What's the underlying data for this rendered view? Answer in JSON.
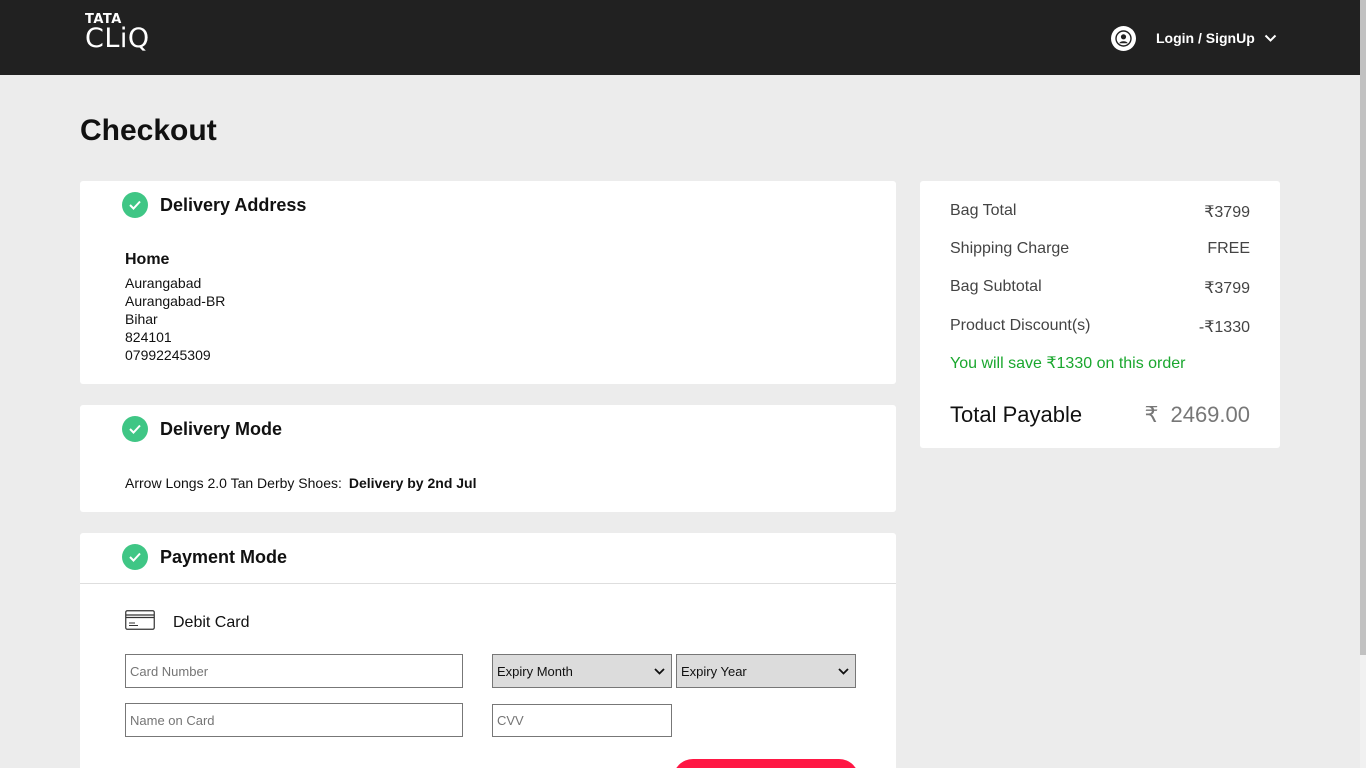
{
  "header": {
    "logo_top": "TATA",
    "logo_bottom": "CLiQ",
    "account_label": "Login / SignUp"
  },
  "page_title": "Checkout",
  "delivery_address": {
    "title": "Delivery Address",
    "label": "Home",
    "lines": [
      "Aurangabad",
      "Aurangabad-BR",
      "Bihar",
      "824101",
      "07992245309"
    ]
  },
  "delivery_mode": {
    "title": "Delivery Mode",
    "product": "Arrow Longs 2.0 Tan Derby Shoes:",
    "delivery": "Delivery by 2nd Jul"
  },
  "payment_mode": {
    "title": "Payment Mode",
    "method": "Debit Card",
    "card_number_placeholder": "Card Number",
    "expiry_month": "Expiry Month",
    "expiry_year": "Expiry Year",
    "name_placeholder": "Name on Card",
    "cvv_placeholder": "CVV"
  },
  "summary": {
    "rows": [
      {
        "label": "Bag Total",
        "value": "₹3799"
      },
      {
        "label": "Shipping Charge",
        "value": "FREE"
      },
      {
        "label": "Bag Subtotal",
        "value": "₹3799"
      },
      {
        "label": "Product Discount(s)",
        "value": "-₹1330"
      }
    ],
    "savings": "You will save ₹1330 on this order",
    "total_label": "Total Payable",
    "currency": "₹",
    "total_value": "2469.00"
  },
  "colors": {
    "header_bg": "#212121",
    "check_green": "#3fc685",
    "savings_green": "#1aa72e",
    "button_red": "#ff1744"
  }
}
